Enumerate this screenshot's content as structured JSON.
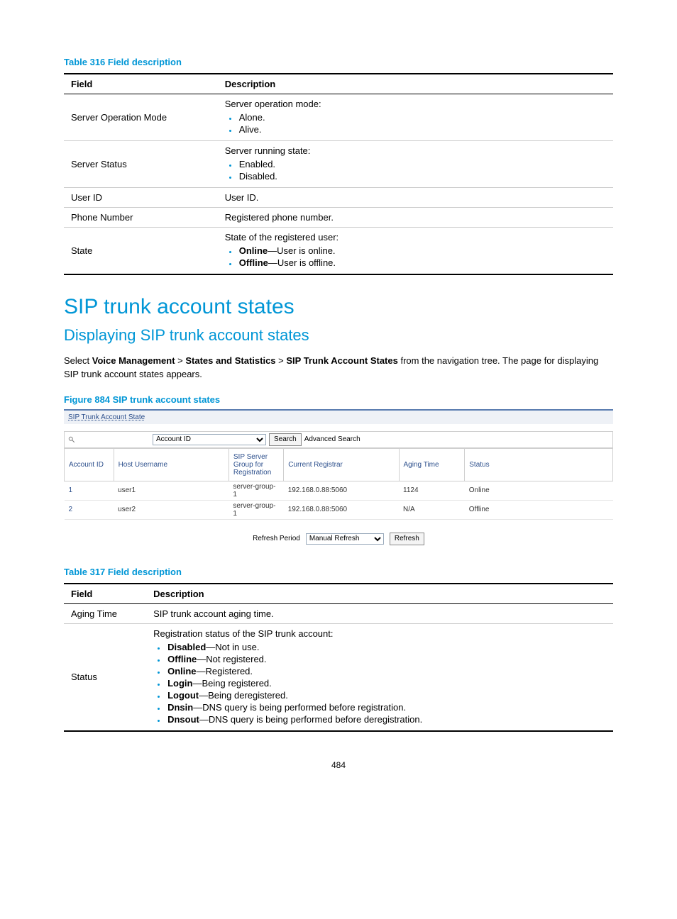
{
  "table316": {
    "caption": "Table 316 Field description",
    "headers": {
      "field": "Field",
      "description": "Description"
    },
    "rows": [
      {
        "field": "Server Operation Mode",
        "intro": "Server operation mode:",
        "items": [
          {
            "bold": "",
            "plain": "Alone."
          },
          {
            "bold": "",
            "plain": "Alive."
          }
        ]
      },
      {
        "field": "Server Status",
        "intro": "Server running state:",
        "items": [
          {
            "bold": "",
            "plain": "Enabled."
          },
          {
            "bold": "",
            "plain": "Disabled."
          }
        ]
      },
      {
        "field": "User ID",
        "intro": "User ID.",
        "items": []
      },
      {
        "field": "Phone Number",
        "intro": "Registered phone number.",
        "items": []
      },
      {
        "field": "State",
        "intro": "State of the registered user:",
        "items": [
          {
            "bold": "Online",
            "plain": "—User is online."
          },
          {
            "bold": "Offline",
            "plain": "—User is offline."
          }
        ]
      }
    ]
  },
  "h1": "SIP trunk account states",
  "h2": "Displaying SIP trunk account states",
  "nav_sentence": {
    "prefix": "Select ",
    "b1": "Voice Management",
    "sep1": " > ",
    "b2": "States and Statistics",
    "sep2": " > ",
    "b3": "SIP Trunk Account States",
    "suffix": " from the navigation tree. The page for displaying SIP trunk account states appears."
  },
  "figure884": {
    "caption": "Figure 884 SIP trunk account states",
    "tab_label": "SIP Trunk Account State",
    "search": {
      "field": "Account ID",
      "search_btn": "Search",
      "advanced": "Advanced Search"
    },
    "grid_headers": {
      "account_id": "Account ID",
      "host_username": "Host Username",
      "sip_group": "SIP Server Group for Registration",
      "current_registrar": "Current Registrar",
      "aging_time": "Aging Time",
      "status": "Status"
    },
    "grid_rows": [
      {
        "account_id": "1",
        "host_username": "user1",
        "sip_group": "server-group-1",
        "current_registrar": "192.168.0.88:5060",
        "aging_time": "1124",
        "status": "Online"
      },
      {
        "account_id": "2",
        "host_username": "user2",
        "sip_group": "server-group-1",
        "current_registrar": "192.168.0.88:5060",
        "aging_time": "N/A",
        "status": "Offline"
      }
    ],
    "refresh": {
      "label": "Refresh Period",
      "select": "Manual Refresh",
      "button": "Refresh"
    }
  },
  "table317": {
    "caption": "Table 317 Field description",
    "headers": {
      "field": "Field",
      "description": "Description"
    },
    "rows": [
      {
        "field": "Aging Time",
        "intro": "SIP trunk account aging time.",
        "items": []
      },
      {
        "field": "Status",
        "intro": "Registration status of the SIP trunk account:",
        "items": [
          {
            "bold": "Disabled",
            "plain": "—Not in use."
          },
          {
            "bold": "Offline",
            "plain": "—Not registered."
          },
          {
            "bold": "Online",
            "plain": "—Registered."
          },
          {
            "bold": "Login",
            "plain": "—Being registered."
          },
          {
            "bold": "Logout",
            "plain": "—Being deregistered."
          },
          {
            "bold": "Dnsin",
            "plain": "—DNS query is being performed before registration."
          },
          {
            "bold": "Dnsout",
            "plain": "—DNS query is being performed before deregistration."
          }
        ]
      }
    ]
  },
  "page_number": "484"
}
